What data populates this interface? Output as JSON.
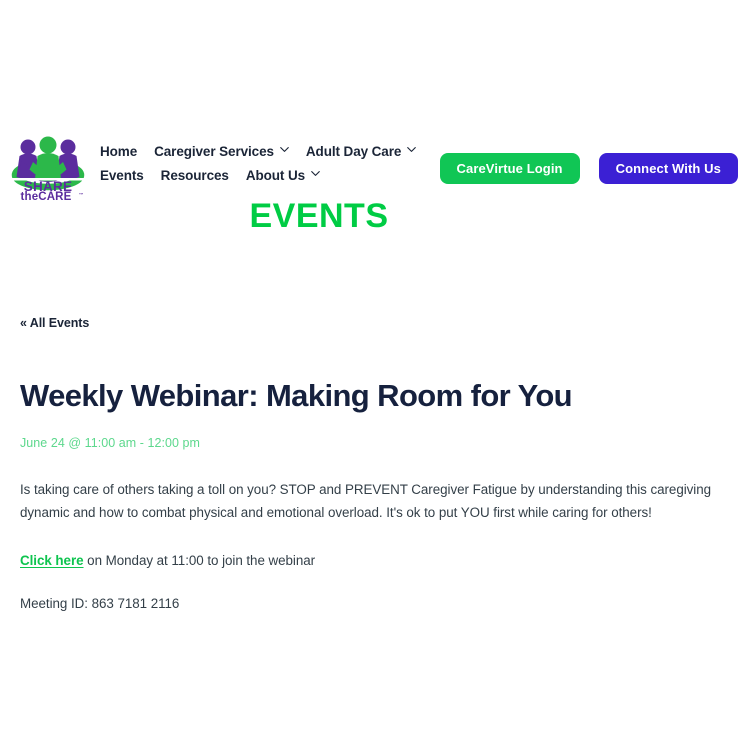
{
  "brand": {
    "logo_line1": "SHARE",
    "logo_line2": "theCARE",
    "logo_tm": "™",
    "colors": {
      "green": "#10c655",
      "bright_green": "#00cc44",
      "light_green": "#5dd88d",
      "purple": "#3b20d4",
      "logo_purple": "#5b2d9e",
      "logo_green": "#2cb84a",
      "navy": "#1b2537",
      "title_navy": "#16213e",
      "body_text": "#333f48"
    }
  },
  "nav": {
    "row1": [
      {
        "label": "Home",
        "has_dropdown": false
      },
      {
        "label": "Caregiver Services",
        "has_dropdown": true
      },
      {
        "label": "Adult Day Care",
        "has_dropdown": true
      }
    ],
    "row2": [
      {
        "label": "Events",
        "has_dropdown": false
      },
      {
        "label": "Resources",
        "has_dropdown": false
      },
      {
        "label": "About Us",
        "has_dropdown": true
      }
    ]
  },
  "header_buttons": {
    "login_label": "CareVirtue Login",
    "connect_label": "Connect With Us"
  },
  "page": {
    "section_title": "EVENTS",
    "back_link": "« All Events",
    "event_title": "Weekly Webinar: Making Room for You",
    "event_date": "June 24 @ 11:00 am - 12:00 pm",
    "event_body": "Is taking care of others taking a toll on you? STOP and PREVENT Caregiver Fatigue by understanding this caregiving dynamic and how to combat physical and emotional overload. It's ok to put YOU first while caring for others!",
    "join_link_label": "Click here",
    "join_text": " on Monday at 11:00 to join the webinar",
    "meeting_id": "Meeting ID: 863 7181 2116"
  }
}
